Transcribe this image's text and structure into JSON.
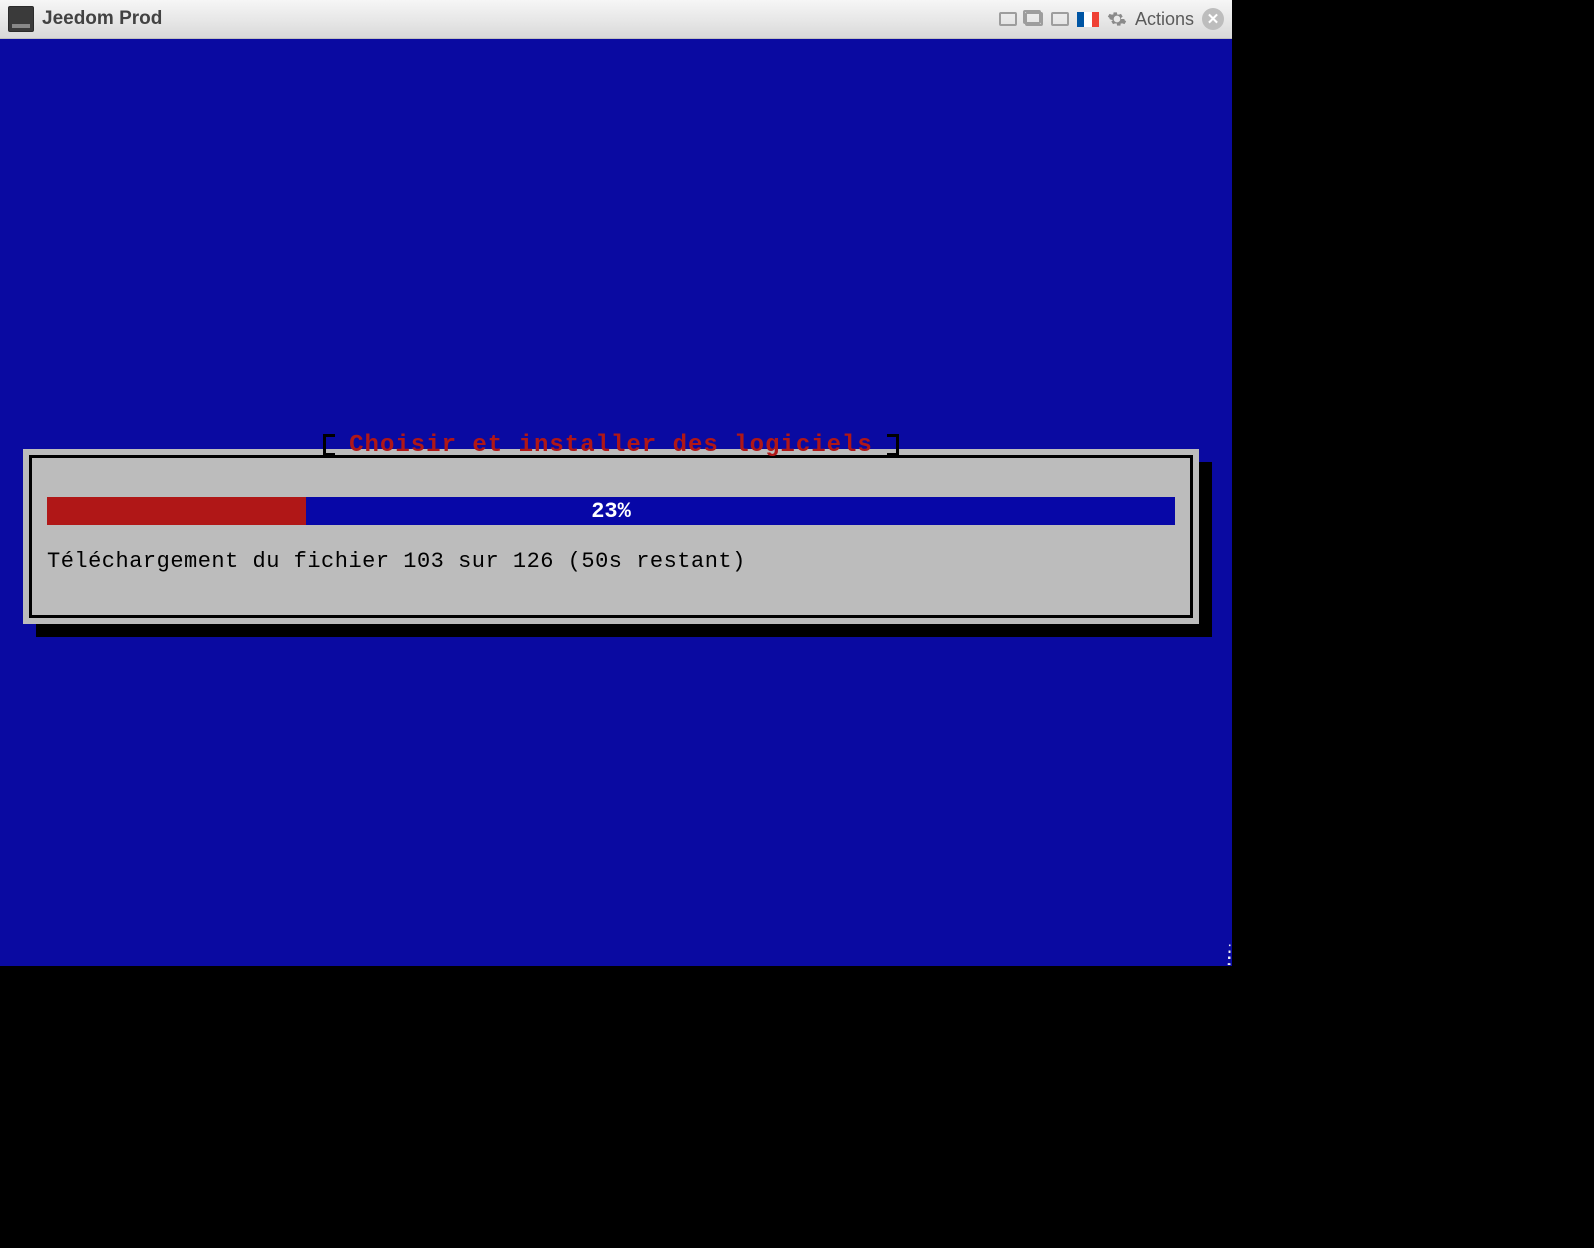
{
  "titlebar": {
    "app_name": "Jeedom Prod",
    "actions_label": "Actions",
    "flag": "france"
  },
  "installer": {
    "title": "Choisir et installer des logiciels",
    "progress_percent": 23,
    "progress_label": "23%",
    "status_text": "Téléchargement du fichier 103 sur 126 (50s restant)",
    "file_current": 103,
    "file_total": 126,
    "time_remaining": "50s"
  },
  "colors": {
    "screen_bg": "#0a0aa1",
    "panel_bg": "#bcbcbc",
    "accent_red": "#b01717",
    "bar_blue": "#0707a7"
  }
}
